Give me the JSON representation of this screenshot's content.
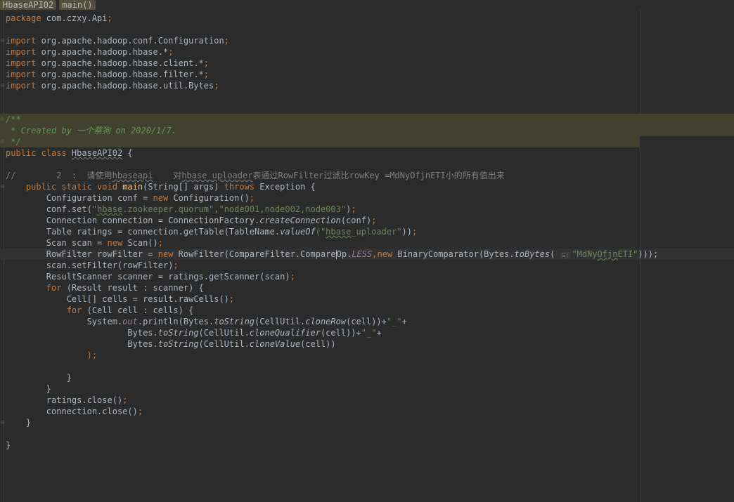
{
  "breadcrumbs": [
    "HbaseAPI02",
    "main()"
  ],
  "code": {
    "package_kw": "package",
    "package_name": " com.czxy.Api",
    "semicolon": ";",
    "imports": [
      {
        "kw": "import",
        "path": " org.apache.hadoop.conf.Configuration"
      },
      {
        "kw": "import",
        "path": " org.apache.hadoop.hbase.*"
      },
      {
        "kw": "import",
        "path": " org.apache.hadoop.hbase.client.*"
      },
      {
        "kw": "import",
        "path": " org.apache.hadoop.hbase.filter.*"
      },
      {
        "kw": "import",
        "path": " org.apache.hadoop.hbase.util.Bytes"
      }
    ],
    "doc_open": "/**",
    "doc_created": " * Created by 一个蔡狗 on 2020/1/7.",
    "doc_close": " */",
    "class_kw": "public class ",
    "class_name": "HbaseAPI02",
    "class_brace": " {",
    "comment": {
      "prefix": "//        2  :  请使用",
      "typo1": "hbaseapi",
      "mid": "    对",
      "typo2": "hbase_uploader",
      "suffix": "表通过RowFilter过滤比rowKey =MdNyOfjnETI小的所有值出来"
    },
    "main_kw": "public static void ",
    "main_name": "main",
    "main_params": "(String[] args) ",
    "throws_kw": "throws",
    "main_exc": " Exception {",
    "conf": {
      "pre": "Configuration conf = ",
      "kw": "new",
      "post": " Configuration()"
    },
    "conf_set": {
      "pre": "conf.set(",
      "q1": "\"",
      "typo": "hbase",
      "key_rest": ".zookeeper.quorum\"",
      "comma": ",",
      "val": "\"node001,node002,node003\"",
      "post": ")"
    },
    "connection": {
      "pre": "Connection connection = ConnectionFactory.",
      "method": "createConnection",
      "post": "(conf)"
    },
    "table": {
      "pre": "Table ratings = connection.getTable(TableName.",
      "method": "valueOf",
      "q1": "(\"",
      "typo": "hbase",
      "rest": "_uploader\"",
      "post": "))"
    },
    "scan": {
      "pre": "Scan scan = ",
      "kw": "new",
      "post": " Scan()"
    },
    "rowfilter": {
      "pre": "RowFilter rowFilter = ",
      "kw": "new",
      "mid": " RowFilter(CompareFilter.Compare",
      "mid2": "Op.",
      "less": "LESS",
      "comma": ",",
      "kw2": "new",
      "mid3": " BinaryComparator(Bytes.",
      "method": "toBytes",
      "paren": "( ",
      "hint": "s:",
      "q1": "\"MdNy",
      "typo": "Ofjn",
      "q2": "ETI\"",
      "post": ")));"
    },
    "setfilter": "scan.setFilter(rowFilter)",
    "scanner": "ResultScanner scanner = ratings.getScanner(scan)",
    "for1": {
      "kw": "for",
      "post": " (Result result : scanner) {"
    },
    "cells": "Cell[] cells = result.rawCells()",
    "for2": {
      "kw": "for",
      "post": " (Cell cell : cells) {"
    },
    "println1": {
      "pre": "System.",
      "out": "out",
      "mid": ".println(Bytes.",
      "m1": "toString",
      "mid2": "(CellUtil.",
      "m2": "cloneRow",
      "post": "(cell))+",
      "str": "\"_\"",
      "plus": "+"
    },
    "println2": {
      "pre": "Bytes.",
      "m1": "toString",
      "mid": "(CellUtil.",
      "m2": "cloneQualifier",
      "post": "(cell))+",
      "str": "\"_\"",
      "plus": "+"
    },
    "println3": {
      "pre": "Bytes.",
      "m1": "toString",
      "mid": "(CellUtil.",
      "m2": "cloneValue",
      "post": "(cell))"
    },
    "close_paren": ");",
    "brace_close": "}",
    "ratings_close": "ratings.close()",
    "connection_close": "connection.close()"
  }
}
